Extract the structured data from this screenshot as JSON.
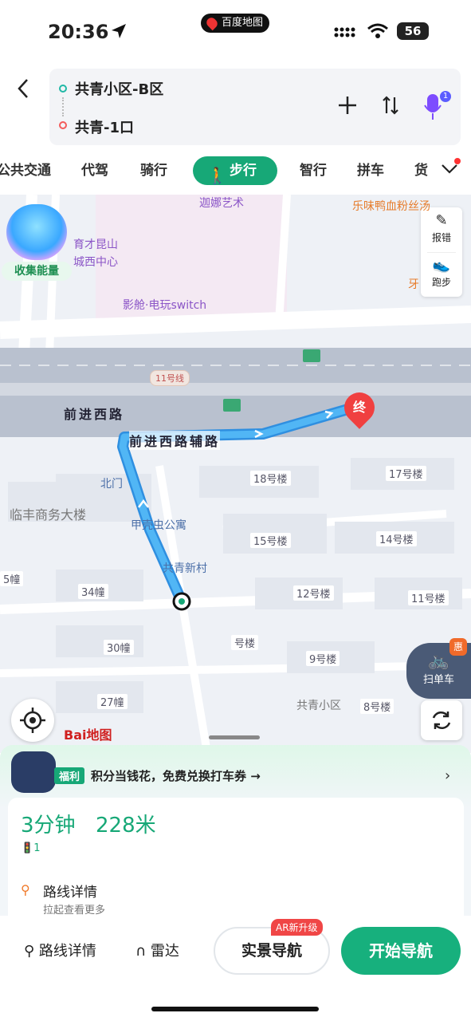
{
  "status_bar": {
    "time": "20:36",
    "app": "百度地图",
    "battery": "56"
  },
  "route": {
    "from": "共青小区-B区",
    "to": "共青-1口"
  },
  "tabs": [
    {
      "label": "公共交通"
    },
    {
      "label": "代驾"
    },
    {
      "label": "骑行"
    },
    {
      "label": "步行"
    },
    {
      "label": "智行"
    },
    {
      "label": "拼车"
    },
    {
      "label": "货"
    }
  ],
  "map": {
    "energy_label": "收集能量",
    "tools": {
      "report": "报错",
      "run": "跑步"
    },
    "poi": {
      "art": "迦娜艺术",
      "restaurant": "乐味鸭血粉丝汤",
      "education_1": "育才昆山",
      "education_2": "城西中心",
      "cinema": "影舱·电玩switch",
      "dental": "牙",
      "north_gate": "北门",
      "building_linfeng": "临丰商务大楼",
      "apartment": "甲壳虫公寓",
      "village": "共青新村",
      "community": "共青小区"
    },
    "roads": {
      "main": "前进西路",
      "aux": "前进西路辅路",
      "metro": "11号线"
    },
    "buildings": [
      "18号楼",
      "17号楼",
      "15号楼",
      "14号楼",
      "12号楼",
      "11号楼",
      "34幢",
      "30幢",
      "27幢",
      "号楼",
      "9号楼",
      "8号楼",
      "5幢"
    ],
    "end_marker": "终",
    "scan_bike": "扫单车",
    "scan_bike_badge": "惠",
    "logo": "Bai地图"
  },
  "promo": {
    "tag": "福利",
    "text": "积分当钱花，免费兑换打车券 →"
  },
  "summary": {
    "duration": "3分钟",
    "distance": "228米",
    "lights": "1",
    "detail_title": "路线详情",
    "detail_sub": "拉起查看更多"
  },
  "actions": {
    "route_detail": "路线详情",
    "radar": "雷达",
    "ar_tag": "AR新升级",
    "ar_nav": "实景导航",
    "start_nav": "开始导航"
  },
  "colors": {
    "accent": "#17a877",
    "route": "#3aa0e8",
    "end_pin": "#f04040"
  }
}
